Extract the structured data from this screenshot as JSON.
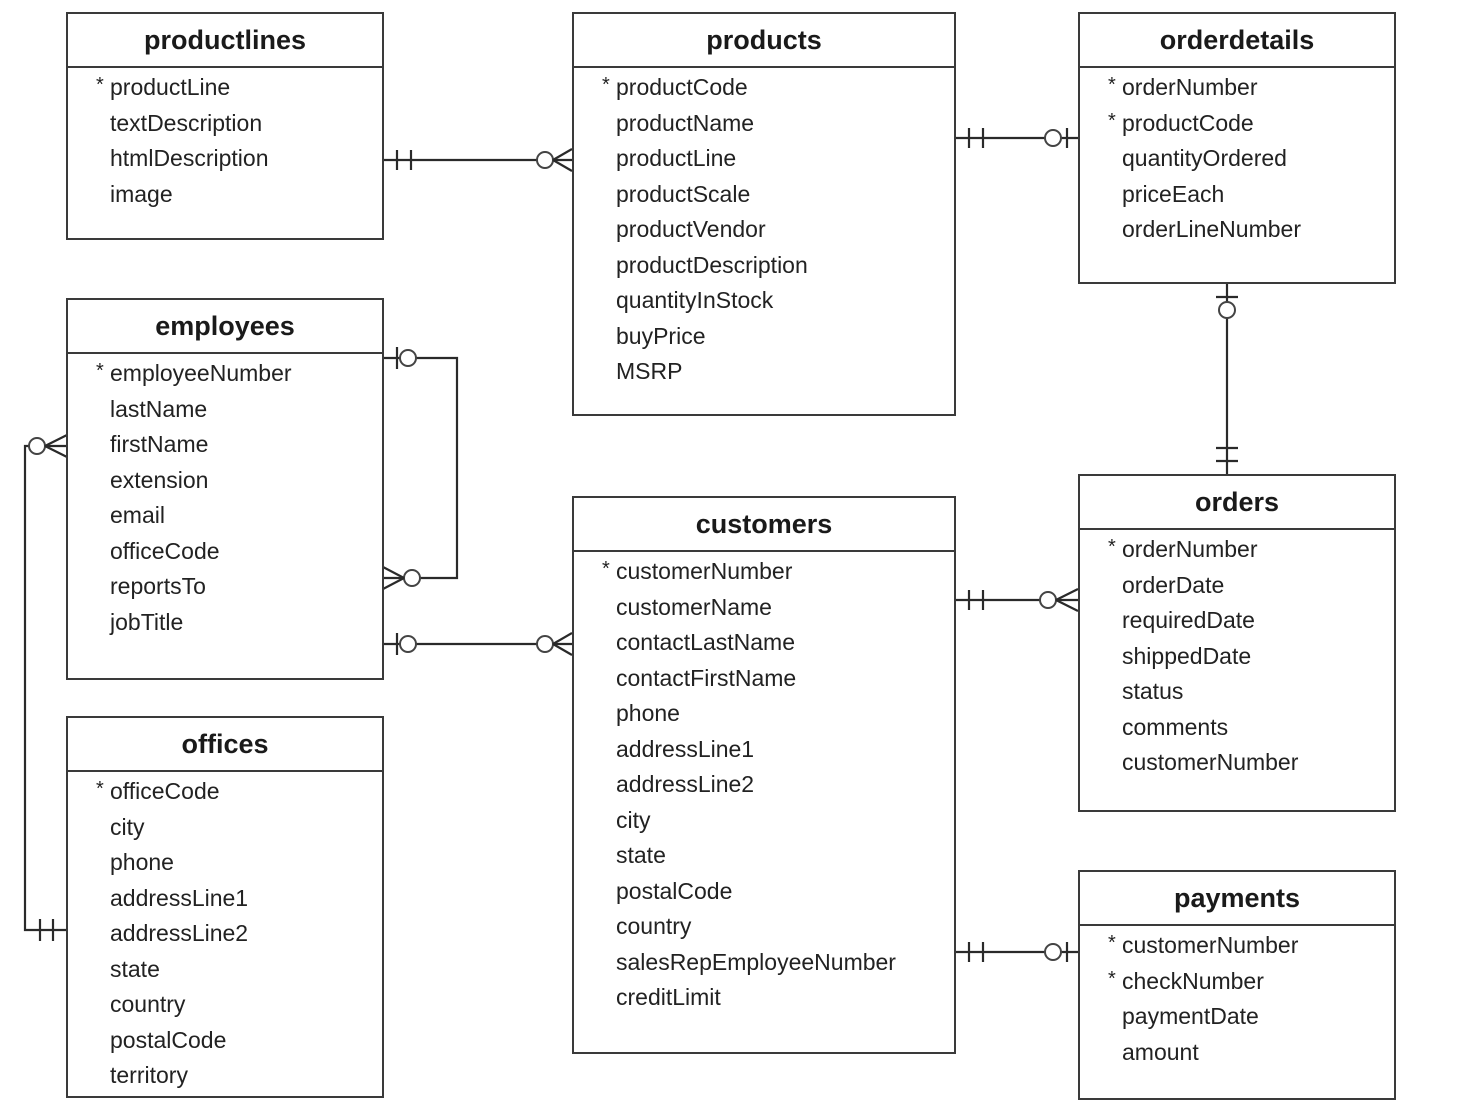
{
  "entities": {
    "productlines": {
      "name": "productlines",
      "fields": [
        {
          "name": "productLine",
          "pk": true
        },
        {
          "name": "textDescription"
        },
        {
          "name": "htmlDescription"
        },
        {
          "name": "image"
        }
      ]
    },
    "products": {
      "name": "products",
      "fields": [
        {
          "name": "productCode",
          "pk": true
        },
        {
          "name": "productName"
        },
        {
          "name": "productLine"
        },
        {
          "name": "productScale"
        },
        {
          "name": "productVendor"
        },
        {
          "name": "productDescription"
        },
        {
          "name": "quantityInStock"
        },
        {
          "name": "buyPrice"
        },
        {
          "name": "MSRP"
        }
      ]
    },
    "orderdetails": {
      "name": "orderdetails",
      "fields": [
        {
          "name": "orderNumber",
          "pk": true
        },
        {
          "name": "productCode",
          "pk": true
        },
        {
          "name": "quantityOrdered"
        },
        {
          "name": "priceEach"
        },
        {
          "name": "orderLineNumber"
        }
      ]
    },
    "employees": {
      "name": "employees",
      "fields": [
        {
          "name": "employeeNumber",
          "pk": true
        },
        {
          "name": "lastName"
        },
        {
          "name": "firstName"
        },
        {
          "name": "extension"
        },
        {
          "name": "email"
        },
        {
          "name": "officeCode"
        },
        {
          "name": "reportsTo"
        },
        {
          "name": "jobTitle"
        }
      ]
    },
    "customers": {
      "name": "customers",
      "fields": [
        {
          "name": "customerNumber",
          "pk": true
        },
        {
          "name": "customerName"
        },
        {
          "name": "contactLastName"
        },
        {
          "name": "contactFirstName"
        },
        {
          "name": "phone"
        },
        {
          "name": "addressLine1"
        },
        {
          "name": "addressLine2"
        },
        {
          "name": "city"
        },
        {
          "name": "state"
        },
        {
          "name": "postalCode"
        },
        {
          "name": "country"
        },
        {
          "name": "salesRepEmployeeNumber"
        },
        {
          "name": "creditLimit"
        }
      ]
    },
    "orders": {
      "name": "orders",
      "fields": [
        {
          "name": "orderNumber",
          "pk": true
        },
        {
          "name": "orderDate"
        },
        {
          "name": "requiredDate"
        },
        {
          "name": "shippedDate"
        },
        {
          "name": "status"
        },
        {
          "name": "comments"
        },
        {
          "name": "customerNumber"
        }
      ]
    },
    "offices": {
      "name": "offices",
      "fields": [
        {
          "name": "officeCode",
          "pk": true
        },
        {
          "name": "city"
        },
        {
          "name": "phone"
        },
        {
          "name": "addressLine1"
        },
        {
          "name": "addressLine2"
        },
        {
          "name": "state"
        },
        {
          "name": "country"
        },
        {
          "name": "postalCode"
        },
        {
          "name": "territory"
        }
      ]
    },
    "payments": {
      "name": "payments",
      "fields": [
        {
          "name": "customerNumber",
          "pk": true
        },
        {
          "name": "checkNumber",
          "pk": true
        },
        {
          "name": "paymentDate"
        },
        {
          "name": "amount"
        }
      ]
    }
  },
  "pk_marker": "*",
  "relationships": [
    {
      "from": "productlines",
      "to": "products",
      "from_card": "one-and-only-one",
      "to_card": "zero-or-many"
    },
    {
      "from": "products",
      "to": "orderdetails",
      "from_card": "one-and-only-one",
      "to_card": "zero-or-one"
    },
    {
      "from": "orders",
      "to": "orderdetails",
      "from_card": "one-and-only-one",
      "to_card": "zero-or-one"
    },
    {
      "from": "employees",
      "to": "employees",
      "from_card": "zero-or-one",
      "to_card": "zero-or-many"
    },
    {
      "from": "employees",
      "to": "customers",
      "from_card": "zero-or-one",
      "to_card": "zero-or-many"
    },
    {
      "from": "offices",
      "to": "employees",
      "from_card": "one-and-only-one",
      "to_card": "zero-or-many"
    },
    {
      "from": "customers",
      "to": "orders",
      "from_card": "one-and-only-one",
      "to_card": "zero-or-many"
    },
    {
      "from": "customers",
      "to": "payments",
      "from_card": "one-and-only-one",
      "to_card": "zero-or-one"
    }
  ]
}
